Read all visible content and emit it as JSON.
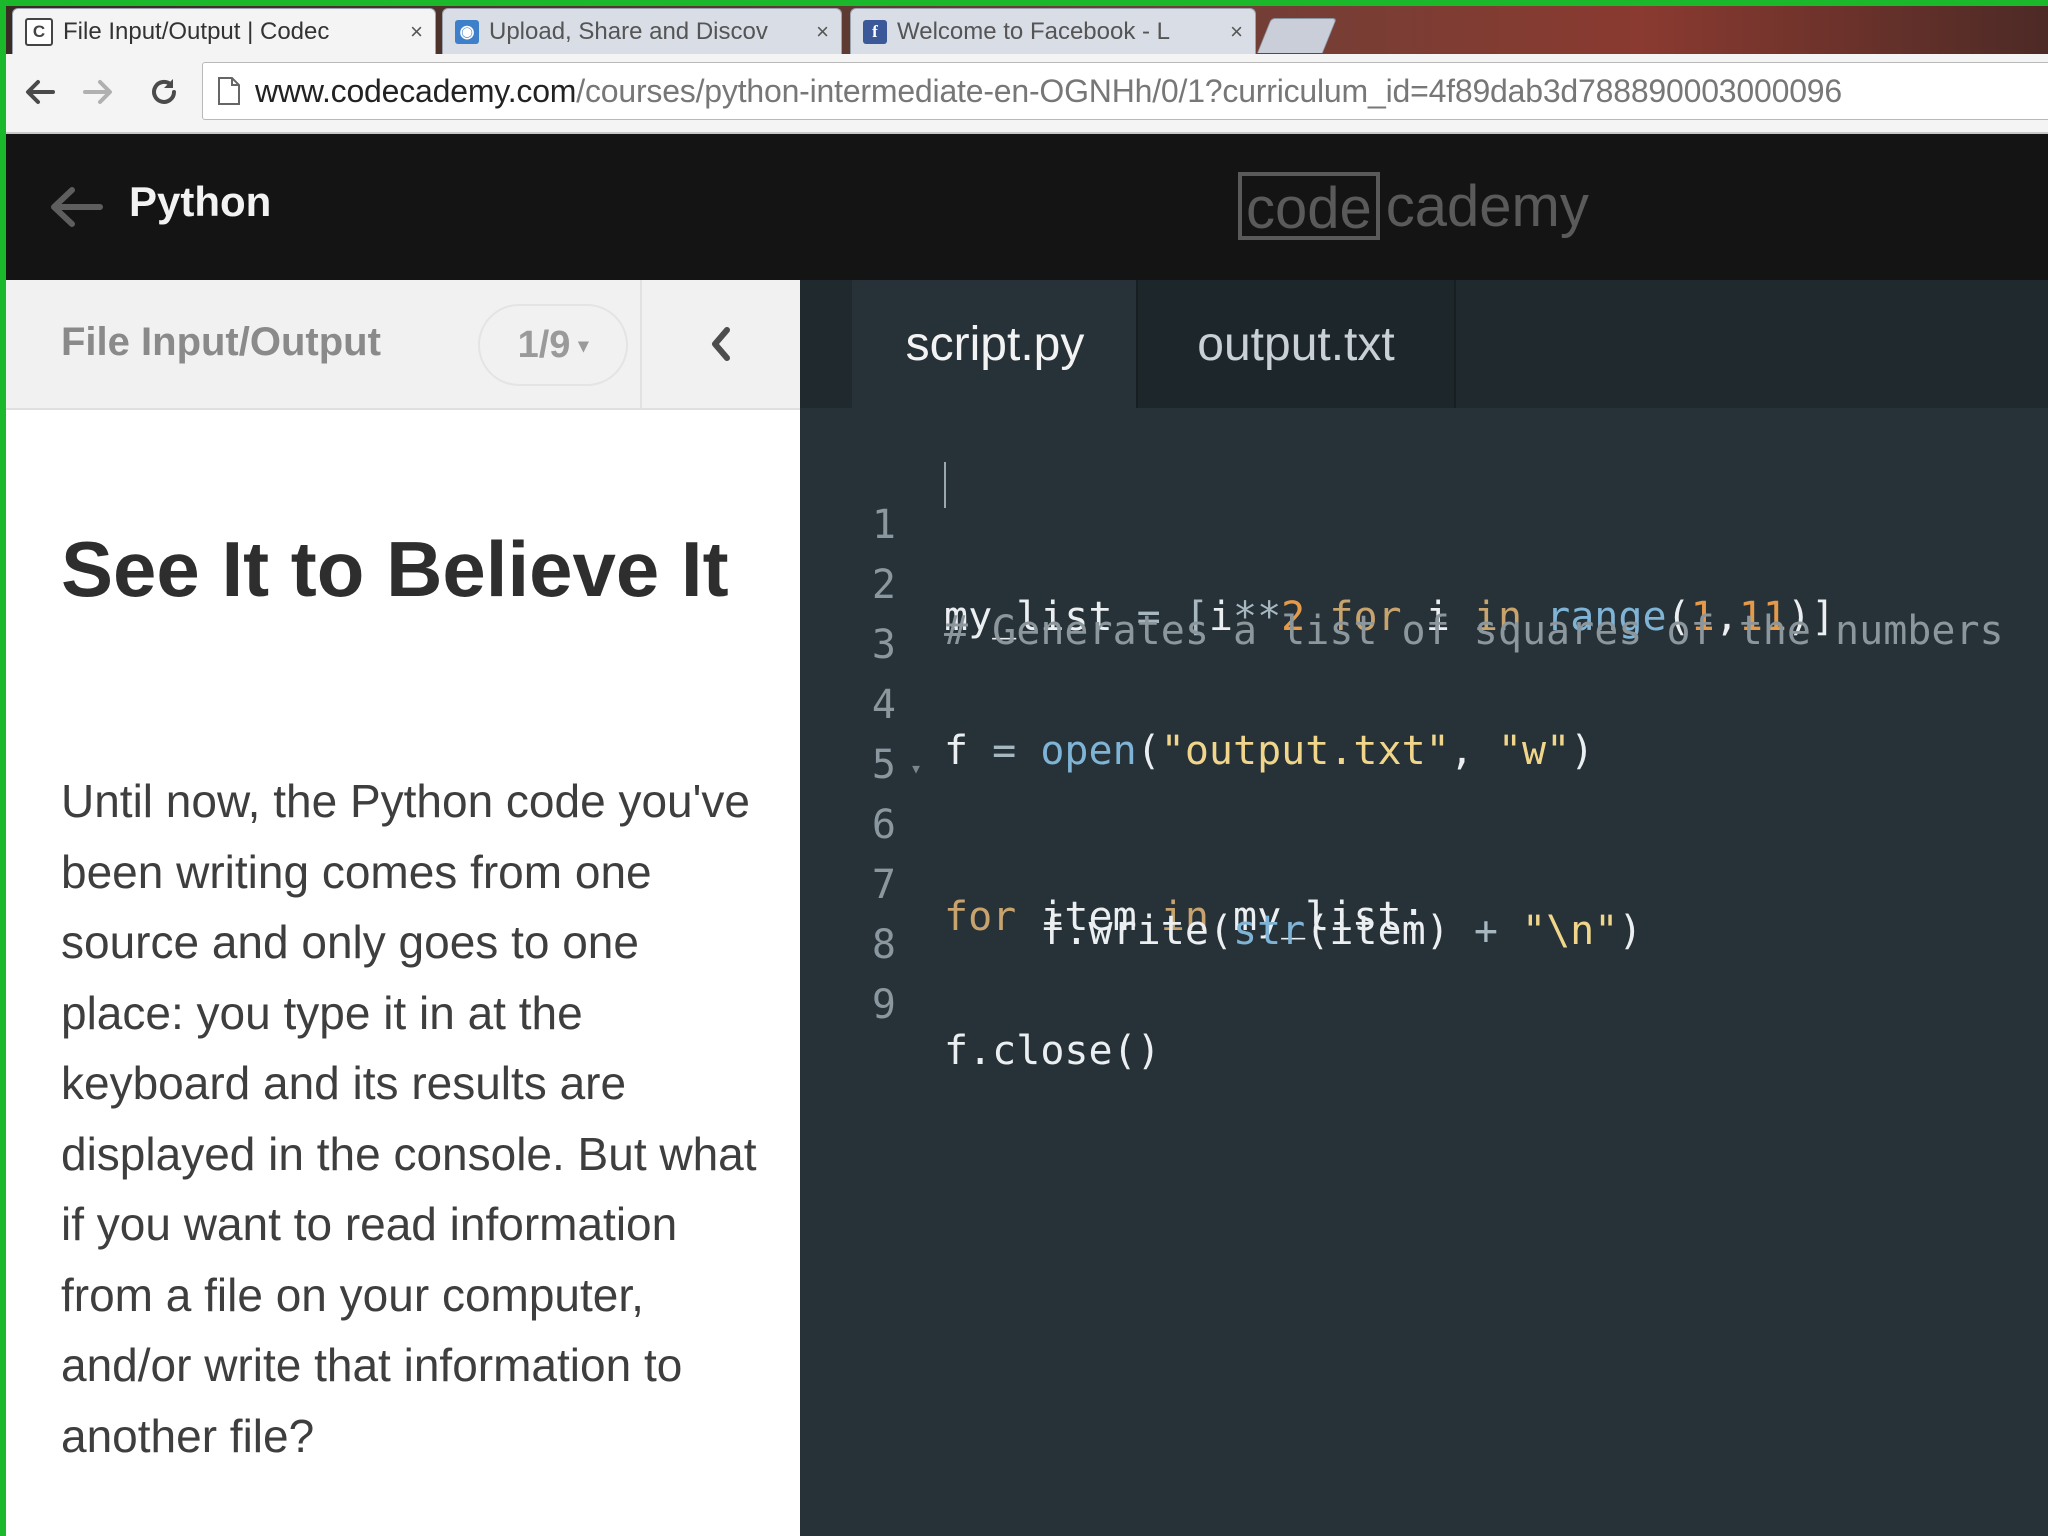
{
  "browser": {
    "tabs": [
      {
        "title": "File Input/Output | Codec",
        "favicon": "codecademy-favicon-icon",
        "active": true
      },
      {
        "title": "Upload, Share and Discov",
        "favicon": "share-favicon-icon",
        "active": false
      },
      {
        "title": "Welcome to Facebook - L",
        "favicon": "facebook-favicon-icon",
        "active": false
      }
    ],
    "close_glyph": "×",
    "url_host": "www.codecademy.com",
    "url_path": "/courses/python-intermediate-en-OGNHh/0/1?curriculum_id=4f89dab3d788890003000096"
  },
  "header": {
    "course_title": "Python",
    "logo_boxed": "code",
    "logo_rest": "cademy"
  },
  "lesson": {
    "section_title": "File Input/Output",
    "progress": "1/9",
    "progress_caret": "▾",
    "heading": "See It to Believe It",
    "body": "Until now, the Python code you've been writing comes from one source and only goes to one place: you type it in at the keyboard and its results are displayed in the console. But what if you want to read information from a file on your computer, and/or write that information to another file?"
  },
  "editor": {
    "tabs": [
      {
        "label": "script.py",
        "active": true
      },
      {
        "label": "output.txt",
        "active": false
      }
    ],
    "lines": [
      {
        "n": "1"
      },
      {
        "n": "2"
      },
      {
        "n": "3"
      },
      {
        "n": "4"
      },
      {
        "n": "5"
      },
      {
        "n": "6",
        "fold": "▾"
      },
      {
        "n": "7"
      },
      {
        "n": "8"
      },
      {
        "n": "9"
      }
    ],
    "tokens": {
      "l1": [
        "my_list",
        " = [",
        "i",
        "**",
        "2",
        " ",
        "for",
        " i ",
        "in",
        " ",
        "range",
        "(",
        "1",
        ",",
        "11",
        ")]"
      ],
      "l2": [
        "# Generates a list of squares of the numbers"
      ],
      "l4": [
        "f",
        " = ",
        "open",
        "(",
        "\"output.txt\"",
        ", ",
        "\"w\"",
        ")"
      ],
      "l6": [
        "for",
        " item ",
        "in",
        " my_list:"
      ],
      "l7": [
        "    f.write(",
        "str",
        "(item) ",
        "+",
        " ",
        "\"\\n\"",
        ")"
      ],
      "l9": [
        "f.close()"
      ]
    }
  },
  "colors": {
    "editor_bg": "#263238",
    "header_bg": "#141414",
    "desktop_green": "#1ab82a"
  }
}
